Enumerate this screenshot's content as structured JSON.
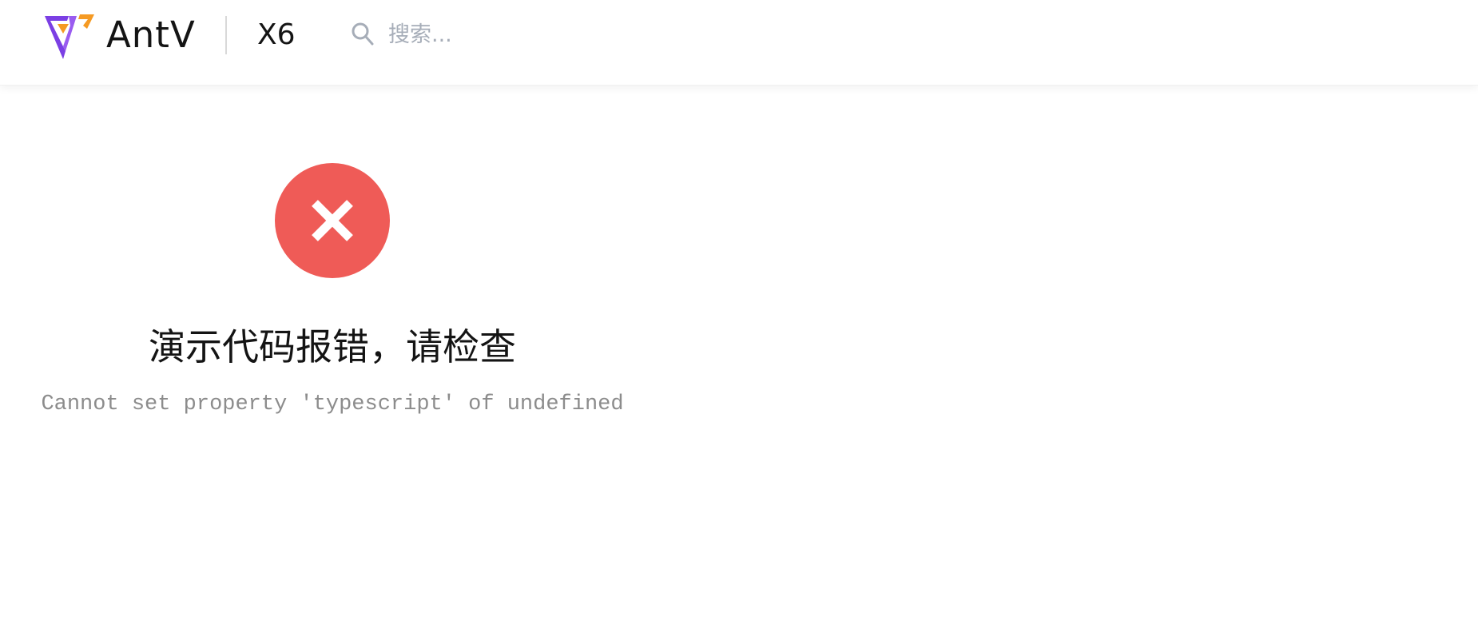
{
  "header": {
    "brand": "AntV",
    "product": "X6",
    "search": {
      "placeholder": "搜索..."
    }
  },
  "error": {
    "icon": "close-icon",
    "title": "演示代码报错，请检查",
    "message": "Cannot set property 'typescript' of undefined"
  },
  "colors": {
    "error_red": "#ef5b57",
    "logo_purple": "#7b3fe4",
    "logo_orange": "#f59a23",
    "text_dark": "#141414",
    "text_muted": "#8c8c8c"
  }
}
